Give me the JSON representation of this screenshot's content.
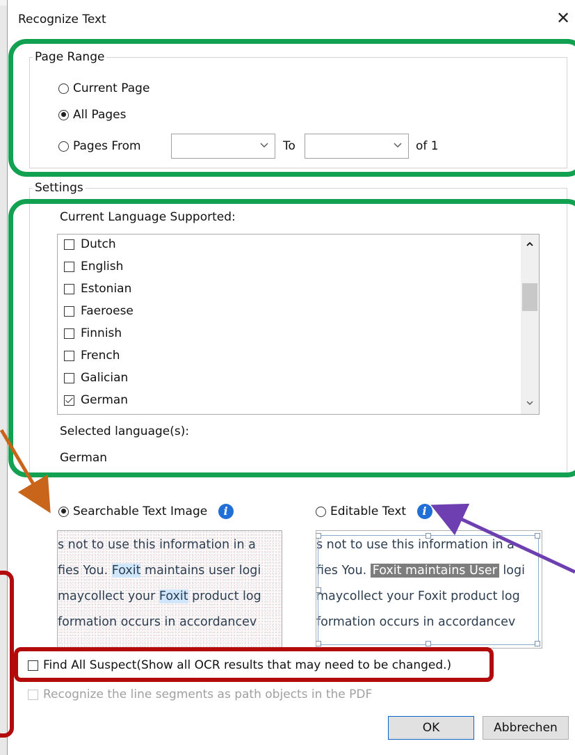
{
  "dialog": {
    "title": "Recognize Text",
    "close_glyph": "✕"
  },
  "page_range": {
    "legend": "Page Range",
    "current_page": "Current Page",
    "all_pages": "All Pages",
    "pages_from": "Pages From",
    "from_value": "",
    "to_label": "To",
    "to_value": "",
    "of_label": "of 1",
    "selected": "all_pages"
  },
  "settings": {
    "legend": "Settings",
    "current_language_label": "Current Language Supported:",
    "languages": [
      {
        "name": "Dutch",
        "checked": false
      },
      {
        "name": "English",
        "checked": false
      },
      {
        "name": "Estonian",
        "checked": false
      },
      {
        "name": "Faeroese",
        "checked": false
      },
      {
        "name": "Finnish",
        "checked": false
      },
      {
        "name": "French",
        "checked": false
      },
      {
        "name": "Galician",
        "checked": false
      },
      {
        "name": "German",
        "checked": true
      }
    ],
    "selected_languages_label": "Selected language(s):",
    "selected_languages_value": "German"
  },
  "output": {
    "searchable_label": "Searchable Text Image",
    "editable_label": "Editable Text",
    "selected": "searchable",
    "info_glyph": "i"
  },
  "preview_searchable": {
    "line1": "s not to use this information in a",
    "line2_pre": "fies You. ",
    "line2_hl": "Foxit",
    "line2_post": " maintains user logi",
    "line3_pre": "maycollect your ",
    "line3_hl": "Foxit",
    "line3_post": " product log",
    "line4": "formation occurs in accordancev"
  },
  "preview_editable": {
    "line1": "s not to use this information in a",
    "line2_pre": "fies You. ",
    "line2_hl": "Foxit maintains User",
    "line2_post": " logi",
    "line3": "maycollect your Foxit product log",
    "line4": "formation occurs in accordancev"
  },
  "options": {
    "find_all_suspect": "Find All Suspect(Show all OCR results that may need to be changed.)",
    "find_all_suspect_checked": false,
    "line_segments": "Recognize the line segments as path objects in the PDF",
    "line_segments_checked": false
  },
  "buttons": {
    "ok": "OK",
    "cancel": "Abbrechen"
  },
  "annotation_colors": {
    "green": "#12a150",
    "red": "#b30b0b",
    "orange": "#c8651a",
    "purple": "#6d3fb0"
  }
}
